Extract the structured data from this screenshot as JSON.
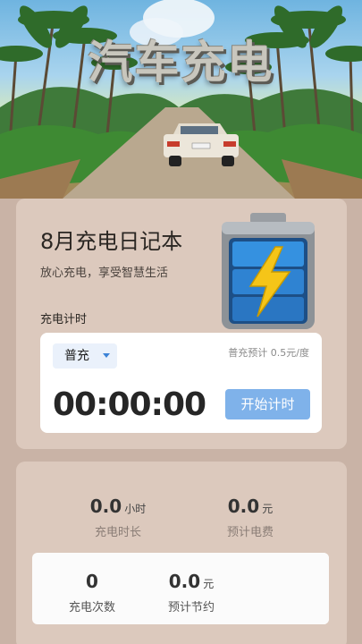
{
  "hero": {
    "title": "汽车充电"
  },
  "diary": {
    "title": "8月充电日记本",
    "subtitle": "放心充电，享受智慧生活",
    "timer_label": "充电计时"
  },
  "timer": {
    "mode": "普充",
    "price": "普充预计 0.5元/度",
    "clock": "00:00:00",
    "start_label": "开始计时"
  },
  "stats": {
    "duration_value": "0.0",
    "duration_unit": "小时",
    "duration_label": "充电时长",
    "cost_value": "0.0",
    "cost_unit": "元",
    "cost_label": "预计电费",
    "count_value": "0",
    "count_label": "充电次数",
    "saving_value": "0.0",
    "saving_unit": "元",
    "saving_label": "预计节约"
  },
  "colors": {
    "page_bg": "#c9b3a6",
    "card_bg": "#dcc9bd",
    "button_bg": "#7fb2ea",
    "battery_blue": "#2f7fd0",
    "bolt_yellow": "#f5c518"
  },
  "icons": {
    "battery": "battery-charging-icon",
    "dropdown": "caret-down-icon"
  }
}
